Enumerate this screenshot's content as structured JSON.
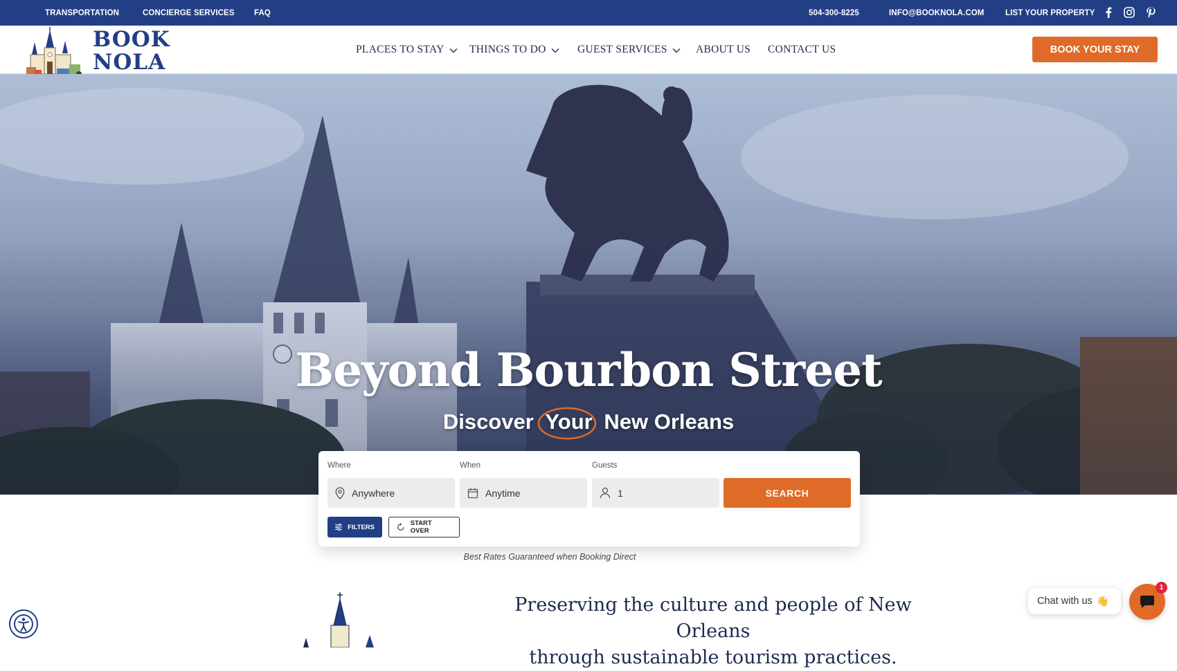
{
  "topbar": {
    "links": [
      "TRANSPORTATION",
      "CONCIERGE SERVICES",
      "FAQ"
    ],
    "phone": "504-300-8225",
    "email": "INFO@BOOKNOLA.COM",
    "list_property": "LIST YOUR PROPERTY",
    "social_icons": [
      "facebook-icon",
      "instagram-icon",
      "pinterest-icon"
    ]
  },
  "logo": {
    "line1": "BOOK",
    "line2": "NOLA"
  },
  "nav": {
    "items": [
      {
        "label": "PLACES TO STAY",
        "dropdown": true
      },
      {
        "label": "THINGS TO DO",
        "dropdown": true
      },
      {
        "label": "GUEST SERVICES",
        "dropdown": true
      },
      {
        "label": "ABOUT US",
        "dropdown": false
      },
      {
        "label": "CONTACT US",
        "dropdown": false
      }
    ],
    "cta": "BOOK YOUR STAY"
  },
  "hero": {
    "title": "Beyond Bourbon Street",
    "subtitle_pre": "Discover",
    "subtitle_highlight": "Your",
    "subtitle_post": "New Orleans"
  },
  "search": {
    "where_label": "Where",
    "where_value": "Anywhere",
    "when_label": "When",
    "when_value": "Anytime",
    "guests_label": "Guests",
    "guests_value": "1",
    "search_button": "SEARCH",
    "filters_button": "FILTERS",
    "start_over_button": "START OVER"
  },
  "rates_note": "Best Rates Guaranteed when Booking Direct",
  "mission": {
    "line1": "Preserving the culture and people of New Orleans",
    "line2": "through sustainable tourism practices."
  },
  "chat": {
    "label": "Chat with us",
    "emoji": "👋",
    "badge": "1"
  },
  "colors": {
    "navy": "#223f86",
    "orange": "#e06b28",
    "badge_red": "#e0243a"
  }
}
